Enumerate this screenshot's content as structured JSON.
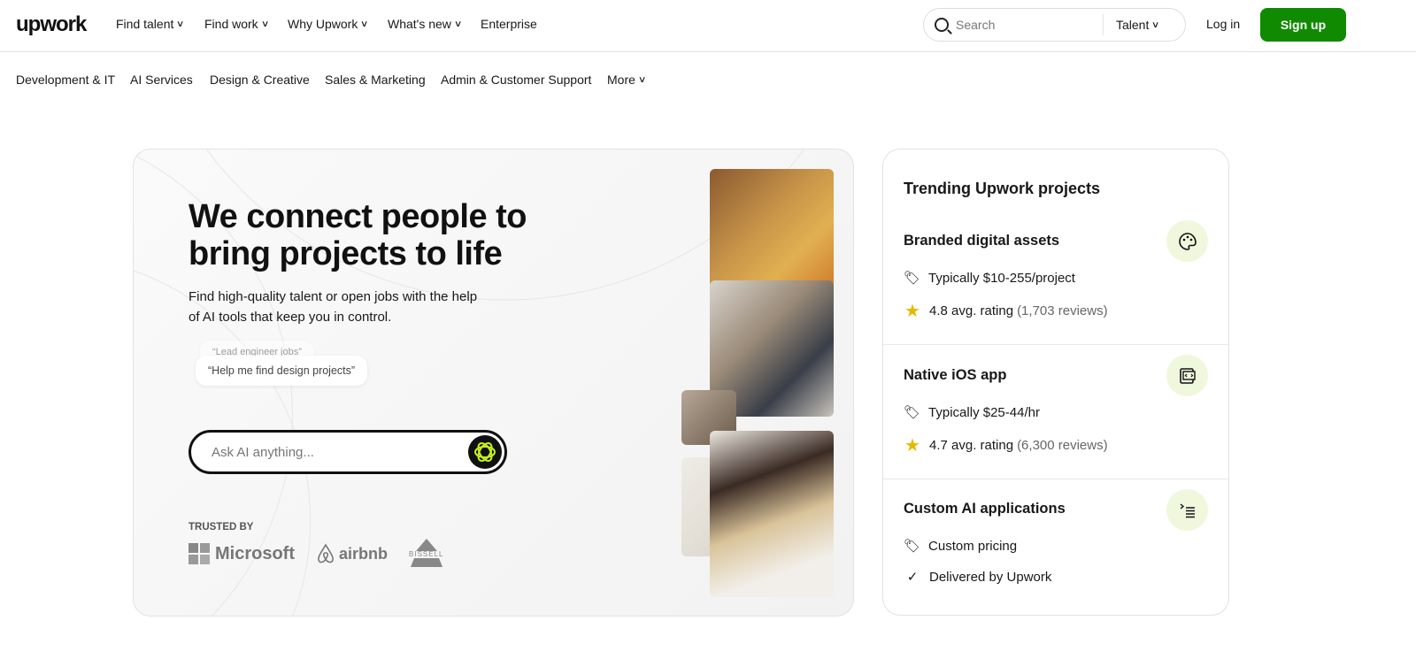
{
  "header": {
    "logo": "upwork",
    "nav": [
      {
        "label": "Find talent",
        "dropdown": true
      },
      {
        "label": "Find work",
        "dropdown": true
      },
      {
        "label": "Why Upwork",
        "dropdown": true
      },
      {
        "label": "What's new",
        "dropdown": true
      },
      {
        "label": "Enterprise",
        "dropdown": false
      }
    ],
    "search": {
      "placeholder": "Search",
      "scope": "Talent"
    },
    "login": "Log in",
    "signup": "Sign up",
    "brand_color": "#108a00"
  },
  "categories": [
    "Development & IT",
    "AI Services",
    "Design & Creative",
    "Sales & Marketing",
    "Admin & Customer Support",
    "More"
  ],
  "hero": {
    "title": "We connect people to bring projects to life",
    "subtitle": "Find high-quality talent or open jobs with the help of AI tools that keep you in control.",
    "suggestions": [
      "“Lead engineer jobs”",
      "“Help me find design projects”"
    ],
    "ask_placeholder": "Ask AI anything...",
    "trusted_by": "TRUSTED BY",
    "logos": [
      "Microsoft",
      "airbnb",
      "BISSELL"
    ]
  },
  "trending": {
    "title": "Trending Upwork projects",
    "projects": [
      {
        "title": "Branded digital assets",
        "icon": "palette-icon",
        "price": "Typically $10-255/project",
        "rating": "4.8 avg. rating",
        "reviews": "(1,703 reviews)"
      },
      {
        "title": "Native iOS app",
        "icon": "code-device-icon",
        "price": "Typically $25-44/hr",
        "rating": "4.7 avg. rating",
        "reviews": "(6,300 reviews)"
      },
      {
        "title": "Custom AI applications",
        "icon": "terminal-list-icon",
        "price": "Custom pricing",
        "delivered": "Delivered by Upwork"
      }
    ]
  }
}
